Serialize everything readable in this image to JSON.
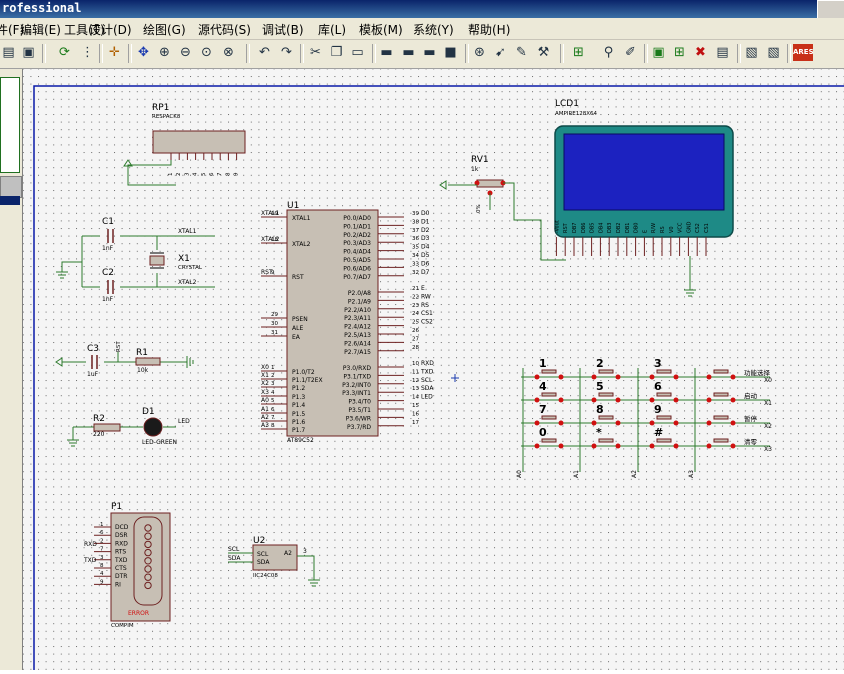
{
  "window": {
    "title": "rofessional"
  },
  "menu": [
    "文件(F)",
    "编辑(E)",
    "工具(T)",
    "设计(D)",
    "绘图(G)",
    "源代码(S)",
    "调试(B)",
    "库(L)",
    "模板(M)",
    "系统(Y)",
    "帮助(H)"
  ],
  "toolbar_icons": [
    "print-icon",
    "open-icon",
    "refresh-icon",
    "grid-icon",
    "origin-icon",
    "pan-icon",
    "zoom-in-icon",
    "zoom-out-icon",
    "zoom-all-icon",
    "zoom-area-icon",
    "undo-icon",
    "redo-icon",
    "cut-icon",
    "copy-icon",
    "paste-icon",
    "block-copy-icon",
    "block-move-icon",
    "block-rotate-icon",
    "block-delete-icon",
    "pick-device-icon",
    "make-device-icon",
    "package-icon",
    "decompose-icon",
    "wire-autoroute-icon",
    "search-icon",
    "property-assign-icon",
    "new-sheet-icon",
    "remove-sheet-icon",
    "goto-sheet-icon",
    "bom-icon",
    "ares-icon"
  ],
  "ares_label": "ARES",
  "components": {
    "rp1": {
      "ref": "RP1",
      "part": "RESPACK8",
      "pins": [
        "1",
        "2",
        "3",
        "4",
        "5",
        "6",
        "7",
        "8",
        "9"
      ]
    },
    "c1": {
      "ref": "C1",
      "value": "1nF"
    },
    "c2": {
      "ref": "C2",
      "value": "1nF"
    },
    "x1": {
      "ref": "X1",
      "part": "CRYSTAL"
    },
    "xtal1": "XTAL1",
    "xtal2": "XTAL2",
    "c3": {
      "ref": "C3",
      "value": "1uF"
    },
    "r1": {
      "ref": "R1",
      "value": "10k"
    },
    "rst_label": "RST",
    "r2": {
      "ref": "R2",
      "value": "220"
    },
    "d1": {
      "ref": "D1",
      "part": "LED-GREEN"
    },
    "led_label": "LED",
    "rv1": {
      "ref": "RV1",
      "value": "1k",
      "pct": "0%"
    },
    "lcd1": {
      "ref": "LCD1",
      "part": "AMPIRE128X64"
    },
    "u1": {
      "ref": "U1",
      "part": "AT89C52",
      "left_pins": [
        {
          "num": "19",
          "name": "XTAL1",
          "net": "XTAL1"
        },
        {
          "num": "18",
          "name": "XTAL2",
          "net": "XTAL2"
        },
        {
          "num": "9",
          "name": "RST",
          "net": "RST"
        },
        {
          "num": "29",
          "name": "PSEN",
          "net": ""
        },
        {
          "num": "30",
          "name": "ALE",
          "net": ""
        },
        {
          "num": "31",
          "name": "EA",
          "net": ""
        },
        {
          "num": "1",
          "name": "P1.0/T2",
          "net": "X0"
        },
        {
          "num": "2",
          "name": "P1.1/T2EX",
          "net": "X1"
        },
        {
          "num": "3",
          "name": "P1.2",
          "net": "X2"
        },
        {
          "num": "4",
          "name": "P1.3",
          "net": "X3"
        },
        {
          "num": "5",
          "name": "P1.4",
          "net": "A0"
        },
        {
          "num": "6",
          "name": "P1.5",
          "net": "A1"
        },
        {
          "num": "7",
          "name": "P1.6",
          "net": "A2"
        },
        {
          "num": "8",
          "name": "P1.7",
          "net": "A3"
        }
      ],
      "right_pins": [
        {
          "num": "39",
          "name": "P0.0/AD0",
          "net": "D0"
        },
        {
          "num": "38",
          "name": "P0.1/AD1",
          "net": "D1"
        },
        {
          "num": "37",
          "name": "P0.2/AD2",
          "net": "D2"
        },
        {
          "num": "36",
          "name": "P0.3/AD3",
          "net": "D3"
        },
        {
          "num": "35",
          "name": "P0.4/AD4",
          "net": "D4"
        },
        {
          "num": "34",
          "name": "P0.5/AD5",
          "net": "D5"
        },
        {
          "num": "33",
          "name": "P0.6/AD6",
          "net": "D6"
        },
        {
          "num": "32",
          "name": "P0.7/AD7",
          "net": "D7"
        },
        {
          "num": "21",
          "name": "P2.0/A8",
          "net": "E"
        },
        {
          "num": "22",
          "name": "P2.1/A9",
          "net": "RW"
        },
        {
          "num": "23",
          "name": "P2.2/A10",
          "net": "RS"
        },
        {
          "num": "24",
          "name": "P2.3/A11",
          "net": "CS1"
        },
        {
          "num": "25",
          "name": "P2.4/A12",
          "net": "CS2"
        },
        {
          "num": "26",
          "name": "P2.5/A13",
          "net": ""
        },
        {
          "num": "27",
          "name": "P2.6/A14",
          "net": ""
        },
        {
          "num": "28",
          "name": "P2.7/A15",
          "net": ""
        },
        {
          "num": "10",
          "name": "P3.0/RXD",
          "net": "RXD"
        },
        {
          "num": "11",
          "name": "P3.1/TXD",
          "net": "TXD"
        },
        {
          "num": "12",
          "name": "P3.2/INT0",
          "net": "SCL"
        },
        {
          "num": "13",
          "name": "P3.3/INT1",
          "net": "SDA"
        },
        {
          "num": "14",
          "name": "P3.4/T0",
          "net": "LED"
        },
        {
          "num": "15",
          "name": "P3.5/T1",
          "net": ""
        },
        {
          "num": "16",
          "name": "P3.6/WR",
          "net": ""
        },
        {
          "num": "17",
          "name": "P3.7/RD",
          "net": ""
        }
      ]
    },
    "lcd_pins": [
      "CS1",
      "CS2",
      "GND",
      "VCC",
      "V0",
      "RS",
      "R/W",
      "E",
      "DB0",
      "DB1",
      "DB2",
      "DB3",
      "DB4",
      "DB5",
      "DB6",
      "DB7",
      "RST",
      "-Vout"
    ],
    "keypad": {
      "keys": [
        "1",
        "2",
        "3",
        "4",
        "5",
        "6",
        "7",
        "8",
        "9",
        "0",
        "*",
        "#"
      ],
      "row_labels": [
        "功能选择",
        "启动",
        "暂停",
        "清零"
      ],
      "row_nets": [
        "X0",
        "X1",
        "X2",
        "X3"
      ],
      "col_nets": [
        "A0",
        "A1",
        "A2",
        "A3"
      ]
    },
    "p1": {
      "ref": "P1",
      "part": "COMPIM",
      "pins": [
        "DCD",
        "DSR",
        "RXD",
        "RTS",
        "TXD",
        "CTS",
        "DTR",
        "RI"
      ],
      "pin_nums": [
        "1",
        "6",
        "2",
        "7",
        "3",
        "8",
        "4",
        "9"
      ],
      "nets": [
        "RXD",
        "TXD"
      ],
      "status": "ERROR"
    },
    "u2": {
      "ref": "U2",
      "part": "IIC24C08",
      "pins": [
        "SCL",
        "SDA",
        "A2"
      ],
      "nets": [
        "SCL",
        "SDA"
      ],
      "pin3": "3"
    }
  }
}
